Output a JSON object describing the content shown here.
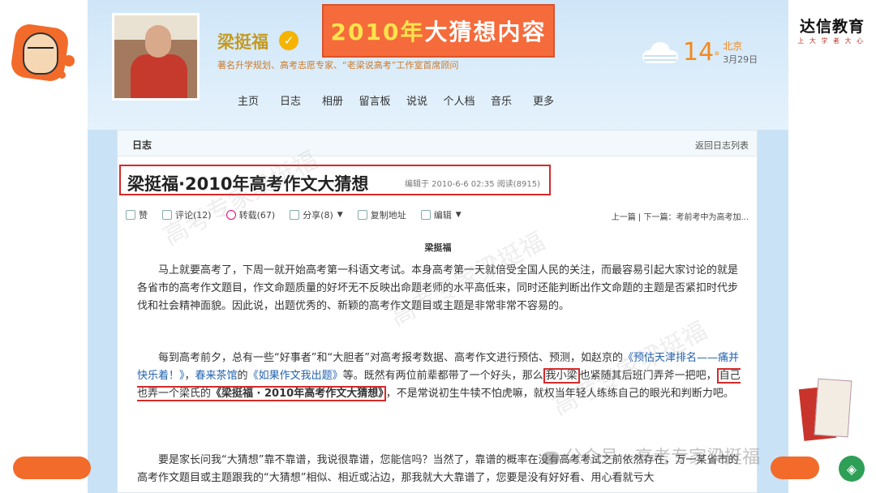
{
  "slide": {
    "banner": {
      "year": "2010年",
      "rest": "大猜想内容"
    },
    "brand": {
      "name": "达信教育",
      "tagline": "上 大 学 者 大 心"
    }
  },
  "blog": {
    "name": "梁挺福",
    "subtitle": "著名升学规划、高考志愿专家、“老梁说高考”工作室首席顾问",
    "nav": [
      "主页",
      "日志",
      "相册",
      "留言板",
      "说说",
      "个人档",
      "音乐",
      "更多"
    ],
    "weather": {
      "temp": "14",
      "deg": "°",
      "city": "北京",
      "date": "3月29日"
    },
    "card": {
      "label": "日志",
      "back": "返回日志列表"
    },
    "post": {
      "title": "梁挺福·2010年高考作文大猜想",
      "meta": "编辑于  2010-6-6 02:35  阅读(8915)"
    },
    "actions": [
      {
        "label": "赞",
        "icon": "thumb-icon"
      },
      {
        "label": "评论(12)",
        "icon": "comment-icon"
      },
      {
        "label": "转载(67)",
        "icon": "repost-icon"
      },
      {
        "label": "分享(8)",
        "icon": "share-icon"
      },
      {
        "label": "复制地址",
        "icon": "copy-icon"
      },
      {
        "label": "编辑",
        "icon": "edit-icon"
      }
    ],
    "nextprev": "上一篇 | 下一篇：考前考中为高考加...",
    "author": "梁挺福",
    "p1": "马上就要高考了，下周一就开始高考第一科语文考试。本身高考第一天就倍受全国人民的关注，而最容易引起大家讨论的就是各省市的高考作文题目，作文命题质量的好坏无不反映出命题老师的水平高低来，同时还能判断出作文命题的主题是否紧扣时代步伐和社会精神面貌。因此说，出题优秀的、新颖的高考作文题目或主题是非常非常不容易的。",
    "p2": {
      "a": "每到高考前夕，总有一些“好事者”和“大胆者”对高考报考数据、高考作文进行预估、预测，如赵京的",
      "link1": "《预估天津排名——痛并快乐着！》",
      "b": "，",
      "link2": "春来茶馆",
      "c": "的",
      "link3": "《如果作文我出题》",
      "d": "等。既然有两位前辈都带了一个好头，那么",
      "hl1": "我小梁",
      "e": "也紧随其后班门弄斧一把吧，",
      "hl2a": "自己也弄一个梁氏的",
      "hl2b": "《梁挺福 · 2010年高考作文大猜想》",
      "f": "，不是常说初生牛犊不怕虎嘛，就权当年轻人练练自己的眼光和判断力吧。"
    },
    "p3": "要是家长问我“大猜想”靠不靠谱，我说很靠谱，您能信吗？当然了，靠谱的概率在没有高考考试之前依然存在，万一某省市的高考作文题目或主题跟我的“大猜想”相似、相近或沾边，那我就大大靠谱了，您要是没有好好看、用心看就亏大",
    "watermark": "高考专家梁挺福",
    "footer": "公众号 · 高考专家梁挺福"
  }
}
